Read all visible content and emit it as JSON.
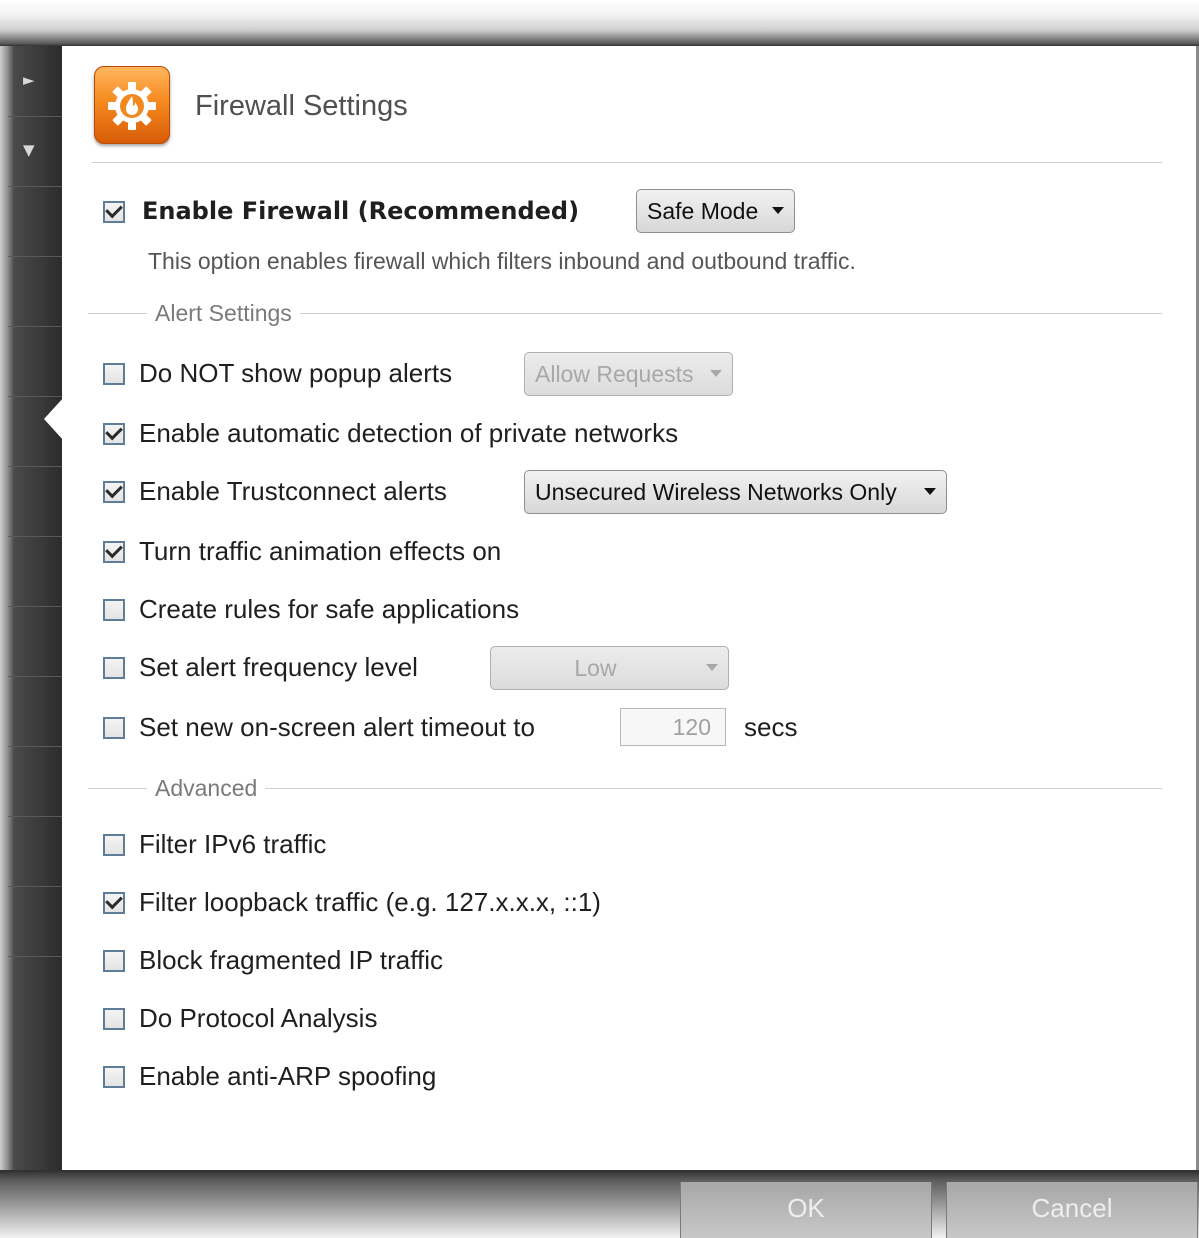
{
  "header": {
    "title": "Firewall Settings",
    "icon": "firewall-gear-flame-icon"
  },
  "enable_firewall": {
    "label": "Enable Firewall (Recommended)",
    "checked": true,
    "mode": "Safe Mode",
    "description": "This option enables firewall which filters inbound and outbound traffic."
  },
  "alert_settings": {
    "heading": "Alert Settings",
    "no_popup": {
      "label": "Do NOT show popup alerts",
      "checked": false,
      "option": "Allow Requests"
    },
    "private_networks": {
      "label": "Enable automatic detection of private networks",
      "checked": true
    },
    "trustconnect": {
      "label": "Enable Trustconnect alerts",
      "checked": true,
      "option": "Unsecured Wireless Networks Only"
    },
    "traffic_animation": {
      "label": "Turn traffic animation effects on",
      "checked": true
    },
    "safe_rules": {
      "label": "Create rules for safe applications",
      "checked": false
    },
    "frequency": {
      "label": "Set alert frequency level",
      "checked": false,
      "option": "Low"
    },
    "timeout": {
      "label": "Set new on-screen alert timeout to",
      "checked": false,
      "value": "120",
      "unit": "secs"
    }
  },
  "advanced": {
    "heading": "Advanced",
    "ipv6": {
      "label": "Filter IPv6 traffic",
      "checked": false
    },
    "loopback": {
      "label": "Filter loopback traffic (e.g. 127.x.x.x, ::1)",
      "checked": true
    },
    "fragmented": {
      "label": "Block fragmented IP traffic",
      "checked": false
    },
    "protocol": {
      "label": "Do Protocol Analysis",
      "checked": false
    },
    "anti_arp": {
      "label": "Enable anti-ARP spoofing",
      "checked": false
    }
  },
  "footer": {
    "ok": "OK",
    "cancel": "Cancel"
  },
  "colors": {
    "accent_orange": "#f58a1f",
    "checkbox_border": "#5d7d99"
  }
}
